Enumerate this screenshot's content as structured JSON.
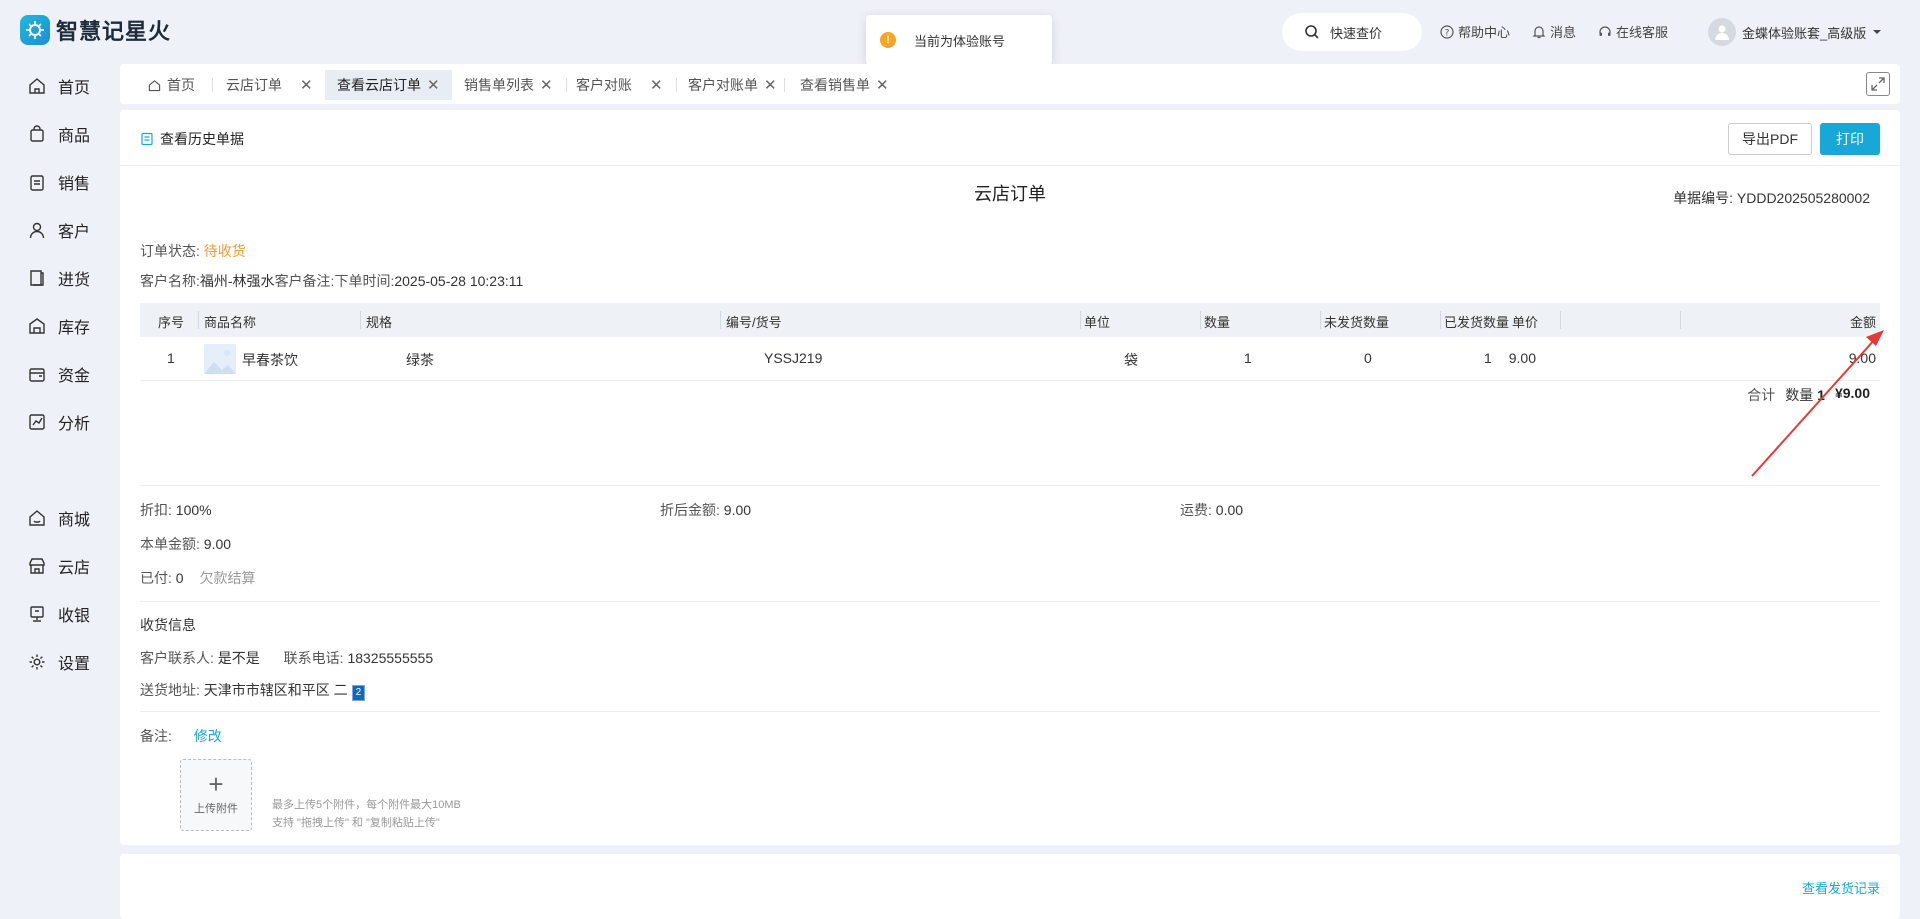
{
  "app": {
    "name": "智慧记星火"
  },
  "toast": {
    "text": "当前为体验账号"
  },
  "header": {
    "search_label": "快速查价",
    "links": [
      {
        "label": "帮助中心",
        "icon": "help-circle-icon"
      },
      {
        "label": "消息",
        "icon": "bell-icon"
      },
      {
        "label": "在线客服",
        "icon": "headset-icon"
      }
    ],
    "user_name": "金蝶体验账套_高级版"
  },
  "sidebar": {
    "items": [
      {
        "label": "首页",
        "icon": "home-icon"
      },
      {
        "label": "商品",
        "icon": "bag-icon"
      },
      {
        "label": "销售",
        "icon": "clipboard-icon"
      },
      {
        "label": "客户",
        "icon": "user-icon"
      },
      {
        "label": "进货",
        "icon": "book-icon"
      },
      {
        "label": "库存",
        "icon": "warehouse-icon"
      },
      {
        "label": "资金",
        "icon": "wallet-icon"
      },
      {
        "label": "分析",
        "icon": "chart-icon"
      },
      {
        "label": "商城",
        "icon": "shop-icon"
      },
      {
        "label": "云店",
        "icon": "store-icon"
      },
      {
        "label": "收银",
        "icon": "cashier-icon"
      },
      {
        "label": "设置",
        "icon": "gear-icon"
      }
    ]
  },
  "tabs": [
    {
      "label": "首页",
      "closable": false,
      "active": false
    },
    {
      "label": "云店订单",
      "closable": true,
      "active": false
    },
    {
      "label": "查看云店订单",
      "closable": true,
      "active": true
    },
    {
      "label": "销售单列表",
      "closable": true,
      "active": false
    },
    {
      "label": "客户对账",
      "closable": true,
      "active": false
    },
    {
      "label": "客户对账单",
      "closable": true,
      "active": false
    },
    {
      "label": "查看销售单",
      "closable": true,
      "active": false
    }
  ],
  "toolbar": {
    "history_label": "查看历史单据",
    "export_pdf_label": "导出PDF",
    "print_label": "打印"
  },
  "order": {
    "title": "云店订单",
    "doc_no_label": "单据编号:",
    "doc_no": "YDDD202505280002",
    "status_label": "订单状态:",
    "status": "待收货",
    "customer_label": "客户名称:",
    "customer": "福州-林强水",
    "remark_label": "客户备注:",
    "time_label": "下单时间:",
    "time": "2025-05-28 10:23:11"
  },
  "table": {
    "headers": [
      "序号",
      "商品名称",
      "规格",
      "编号/货号",
      "单位",
      "数量",
      "未发货数量",
      "已发货数量",
      "单价",
      "金额"
    ],
    "rows": [
      {
        "index": "1",
        "name": "早春茶饮",
        "spec": "绿茶",
        "code": "YSSJ219",
        "unit": "袋",
        "qty": "1",
        "unshipped": "0",
        "shipped": "1",
        "price": "9.00",
        "amount": "9.00"
      }
    ],
    "total_label": "合计",
    "total_qty_label": "数量",
    "total_qty": "1",
    "total_amount": "¥9.00"
  },
  "summary": {
    "discount_label": "折扣:",
    "discount": "100%",
    "after_discount_label": "折后金额:",
    "after_discount": "9.00",
    "shipping_label": "运费:",
    "shipping": "0.00",
    "order_amount_label": "本单金额:",
    "order_amount": "9.00",
    "paid_label": "已付:",
    "paid": "0",
    "settle_label": "欠款结算"
  },
  "delivery": {
    "section_title": "收货信息",
    "contact_label": "客户联系人:",
    "contact": "是不是",
    "phone_label": "联系电话:",
    "phone": "18325555555",
    "address_label": "送货地址:",
    "address": "天津市市辖区和平区 二",
    "address_badge": "2"
  },
  "remark": {
    "label": "备注:",
    "edit_label": "修改"
  },
  "attachment": {
    "upload_label": "上传附件",
    "hint_line1": "最多上传5个附件，每个附件最大10MB",
    "hint_line2": "支持 \"拖拽上传\" 和 \"复制粘贴上传\""
  },
  "footer": {
    "shipping_record_label": "查看发货记录"
  },
  "colors": {
    "accent": "#17a8d8",
    "status": "#f39c3c",
    "annotation_arrow": "#e53935"
  }
}
